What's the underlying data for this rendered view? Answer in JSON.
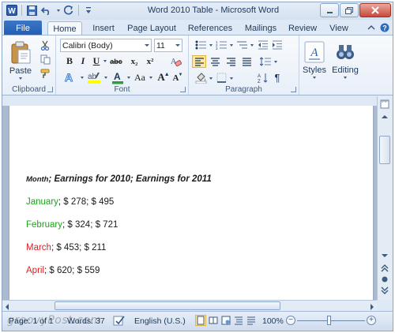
{
  "window": {
    "title": "Word 2010 Table  -  Microsoft Word",
    "app_icon_letter": "W"
  },
  "quick_access": {
    "items": [
      "save-icon",
      "undo-icon",
      "redo-icon",
      "customize-icon"
    ]
  },
  "tabs": {
    "file": "File",
    "items": [
      "Home",
      "Insert",
      "Page Layout",
      "References",
      "Mailings",
      "Review",
      "View"
    ],
    "active": "Home"
  },
  "ribbon": {
    "clipboard": {
      "label": "Clipboard",
      "paste_label": "Paste"
    },
    "font": {
      "label": "Font",
      "font_name": "Calibri (Body)",
      "font_size": "11",
      "bold": "B",
      "italic": "I",
      "underline": "U",
      "strike": "abc",
      "subscript": "x₂",
      "superscript": "x²",
      "change_case": "Aa",
      "grow": "A",
      "shrink": "A"
    },
    "paragraph": {
      "label": "Paragraph",
      "pilcrow": "¶"
    },
    "styles": {
      "label": "Styles"
    },
    "editing": {
      "label": "Editing"
    }
  },
  "document": {
    "heading": {
      "month": "Month",
      "rest": "; Earnings for 2010;  Earnings for 2011"
    },
    "rows": [
      {
        "month": "January",
        "values": "; $ 278; $ 495",
        "color": "#19a319"
      },
      {
        "month": "February",
        "values": "; $ 324;  $ 721",
        "color": "#19a319"
      },
      {
        "month": "March",
        "values": "; $ 453;  $ 211",
        "color": "#e11d1d"
      },
      {
        "month": "April",
        "values": "; $ 620;  $ 559",
        "color": "#e11d1d"
      }
    ]
  },
  "statusbar": {
    "page": "Page: 1 of 1",
    "words": "Words: 37",
    "language": "English (U.S.)",
    "zoom": "100%",
    "zoom_minus": "−",
    "zoom_plus": "+",
    "watermark": "groovyPost.com"
  },
  "colors": {
    "accent": "#1f5eb5",
    "green_text": "#19a319",
    "red_text": "#e11d1d"
  }
}
